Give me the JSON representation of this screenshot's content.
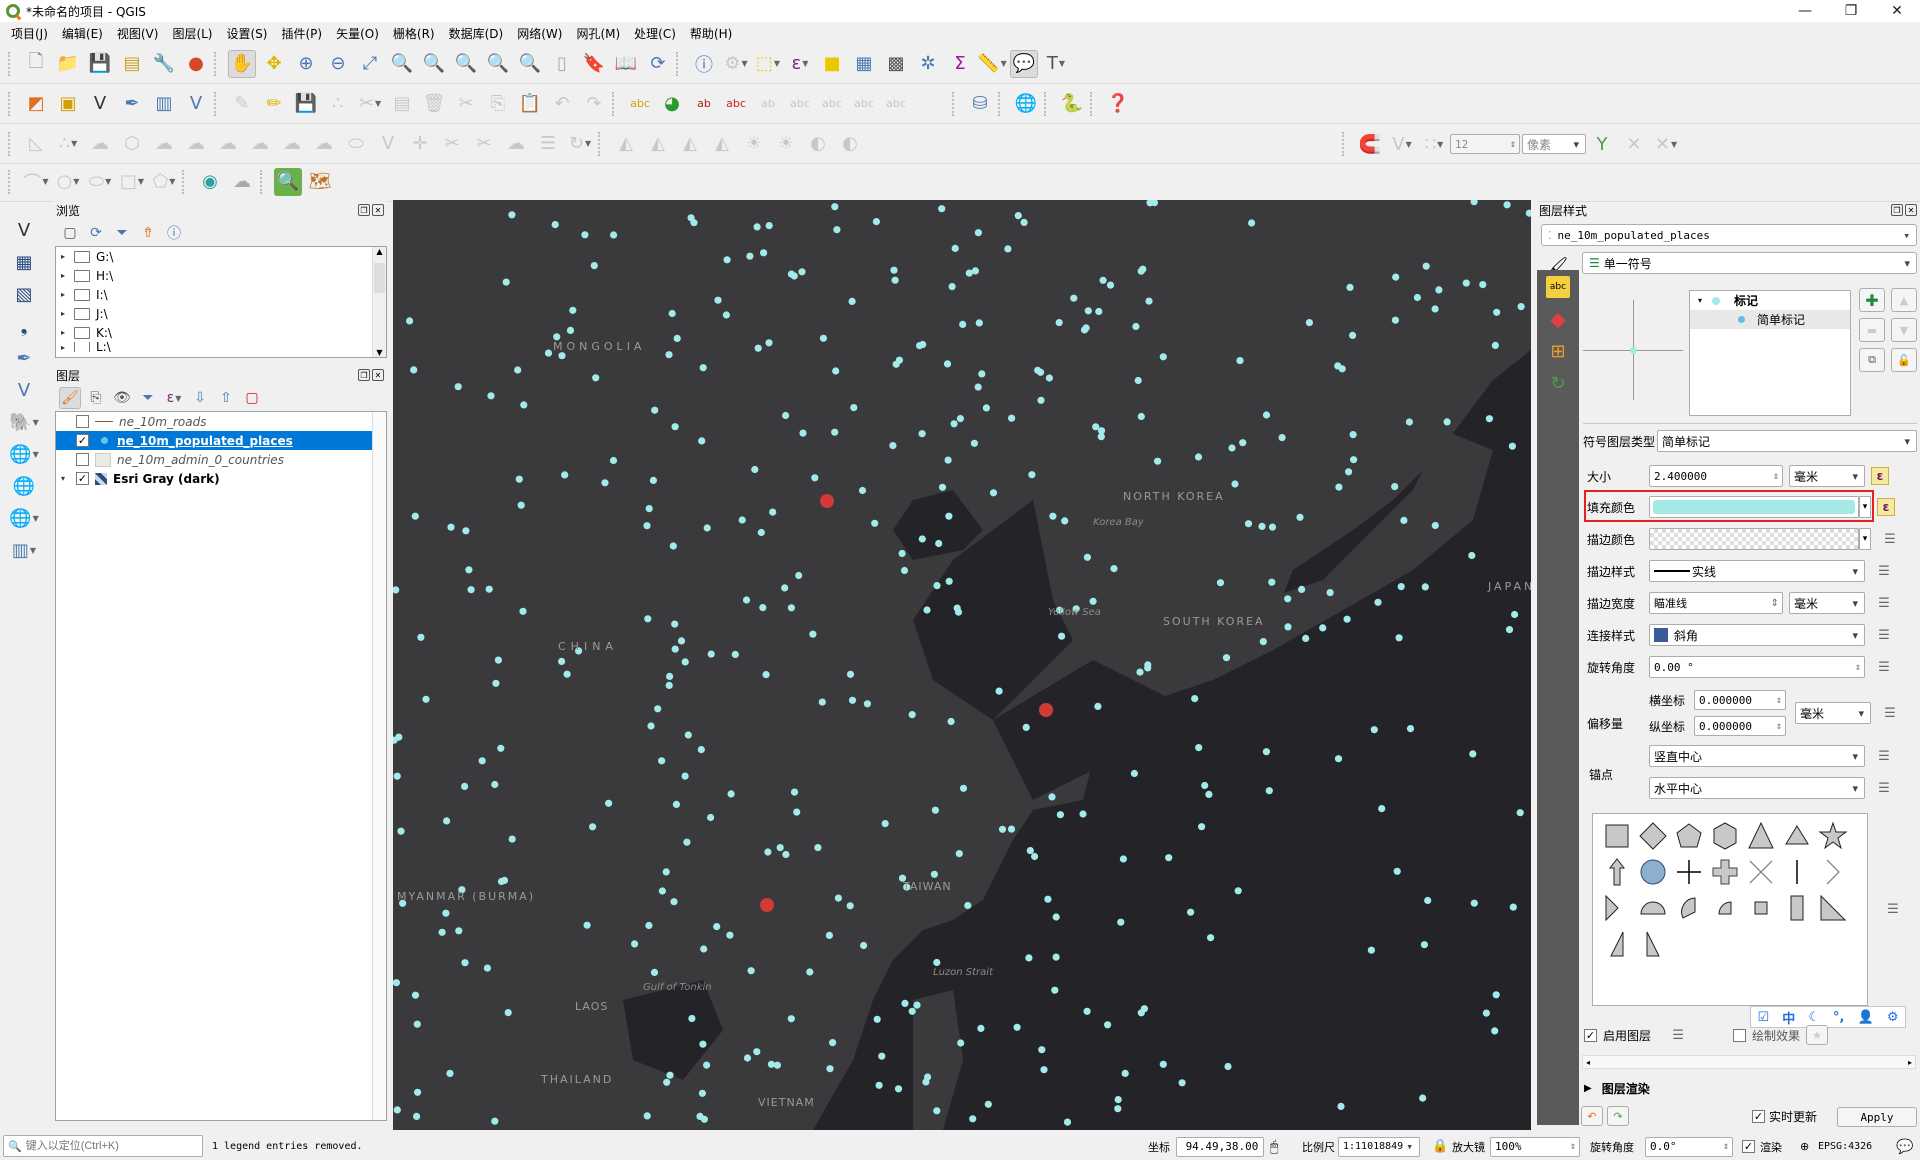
{
  "window": {
    "title": "*未命名的项目 - QGIS",
    "minimize": "—",
    "restore": "❐",
    "close": "✕"
  },
  "menu": [
    "项目(J)",
    "编辑(E)",
    "视图(V)",
    "图层(L)",
    "设置(S)",
    "插件(P)",
    "矢量(O)",
    "栅格(R)",
    "数据库(D)",
    "网络(W)",
    "网孔(M)",
    "处理(C)",
    "帮助(H)"
  ],
  "snapping": {
    "tolerance": "12",
    "unit": "像素"
  },
  "browser": {
    "title": "浏览",
    "items": [
      "G:\\",
      "H:\\",
      "I:\\",
      "J:\\",
      "K:\\",
      "L:\\"
    ]
  },
  "layers": {
    "title": "图层",
    "items": [
      {
        "name": "ne_10m_roads",
        "checked": false,
        "selected": false,
        "symbol": "line"
      },
      {
        "name": "ne_10m_populated_places",
        "checked": true,
        "selected": true,
        "symbol": "point"
      },
      {
        "name": "ne_10m_admin_0_countries",
        "checked": false,
        "selected": false,
        "symbol": "polygon"
      },
      {
        "name": "Esri Gray (dark)",
        "checked": true,
        "selected": false,
        "symbol": "raster"
      }
    ]
  },
  "map": {
    "labels": {
      "mongolia": "MONGOLIA",
      "china": "CHINA",
      "north_korea": "NORTH KOREA",
      "south_korea": "SOUTH KOREA",
      "japan": "JAPAN",
      "korea_bay": "Korea Bay",
      "yellow_sea": "Yellow Sea",
      "myanmar": "MYANMAR (BURMA)",
      "laos": "LAOS",
      "thailand": "THAILAND",
      "vietnam": "VIETNAM",
      "taiwan": "TAIWAN",
      "gulf_tonkin": "Gulf of Tonkin",
      "luzon_strait": "Luzon Strait"
    },
    "point_color": "#a3eaea",
    "highlight_color": "#d03b35",
    "background": "#3a3a3c",
    "water": "#242428"
  },
  "style_panel": {
    "title": "图层样式",
    "layer": "ne_10m_populated_places",
    "renderer": "单一符号",
    "tree": {
      "root": "标记",
      "child": "简单标记"
    },
    "symbol_layer_type_label": "符号图层类型",
    "symbol_layer_type": "简单标记",
    "size": {
      "label": "大小",
      "value": "2.400000",
      "unit": "毫米"
    },
    "fill_color": {
      "label": "填充颜色",
      "color": "#a3e9e6"
    },
    "stroke_color": {
      "label": "描边颜色"
    },
    "stroke_style": {
      "label": "描边样式",
      "value": "实线"
    },
    "stroke_width": {
      "label": "描边宽度",
      "value": "瞄准线",
      "unit": "毫米"
    },
    "join_style": {
      "label": "连接样式",
      "value": "斜角"
    },
    "rotation": {
      "label": "旋转角度",
      "value": "0.00 °"
    },
    "offset": {
      "label": "偏移量",
      "x_label": "横坐标",
      "x": "0.000000",
      "y_label": "纵坐标",
      "y": "0.000000",
      "unit": "毫米"
    },
    "anchor": {
      "label": "锚点",
      "vertical": "竖直中心",
      "horizontal": "水平中心"
    },
    "enable_layer": "启用图层",
    "draw_effects": "绘制效果",
    "layer_rendering": "图层渲染",
    "live_update": "实时更新",
    "apply": "Apply"
  },
  "ime": {
    "mode": "中"
  },
  "status": {
    "locate_placeholder": "键入以定位(Ctrl+K)",
    "message": "1 legend entries removed.",
    "coord_label": "坐标",
    "coord": "94.49,38.00",
    "scale_label": "比例尺",
    "scale": "1:11018849",
    "magnifier_label": "放大镜",
    "magnifier": "100%",
    "rotation_label": "旋转角度",
    "rotation": "0.0°",
    "render_label": "渲染",
    "crs": "EPSG:4326"
  }
}
